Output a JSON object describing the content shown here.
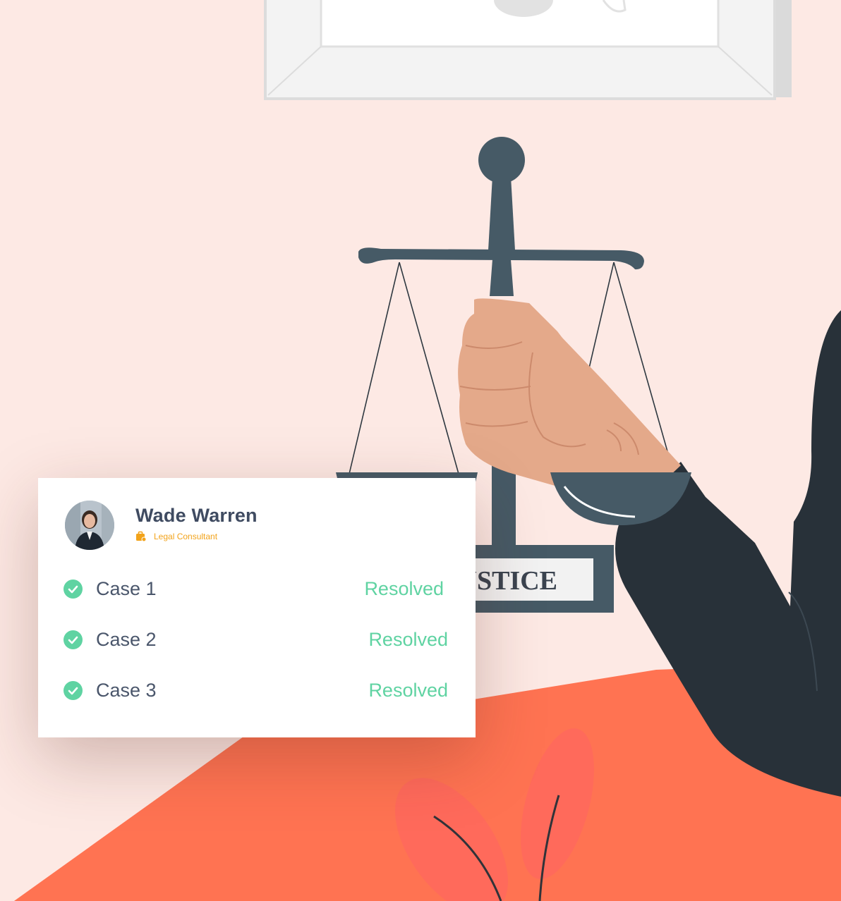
{
  "profile": {
    "name": "Wade Warren",
    "role": "Legal Consultant"
  },
  "cases": [
    {
      "label": "Case 1",
      "status": "Resolved"
    },
    {
      "label": "Case 2",
      "status": "Resolved"
    },
    {
      "label": "Case 3",
      "status": "Resolved"
    }
  ],
  "sign_text": "USTICE",
  "colors": {
    "wall": "#fde9e4",
    "floor": "#ff7352",
    "metal": "#465a66",
    "suit": "#283139",
    "skin": "#e4a98a",
    "resolved": "#5fd3a2",
    "name": "#3f4b61",
    "role": "#f2a31b"
  },
  "icons": {
    "check": "check-circle-icon",
    "role": "briefcase-icon"
  }
}
